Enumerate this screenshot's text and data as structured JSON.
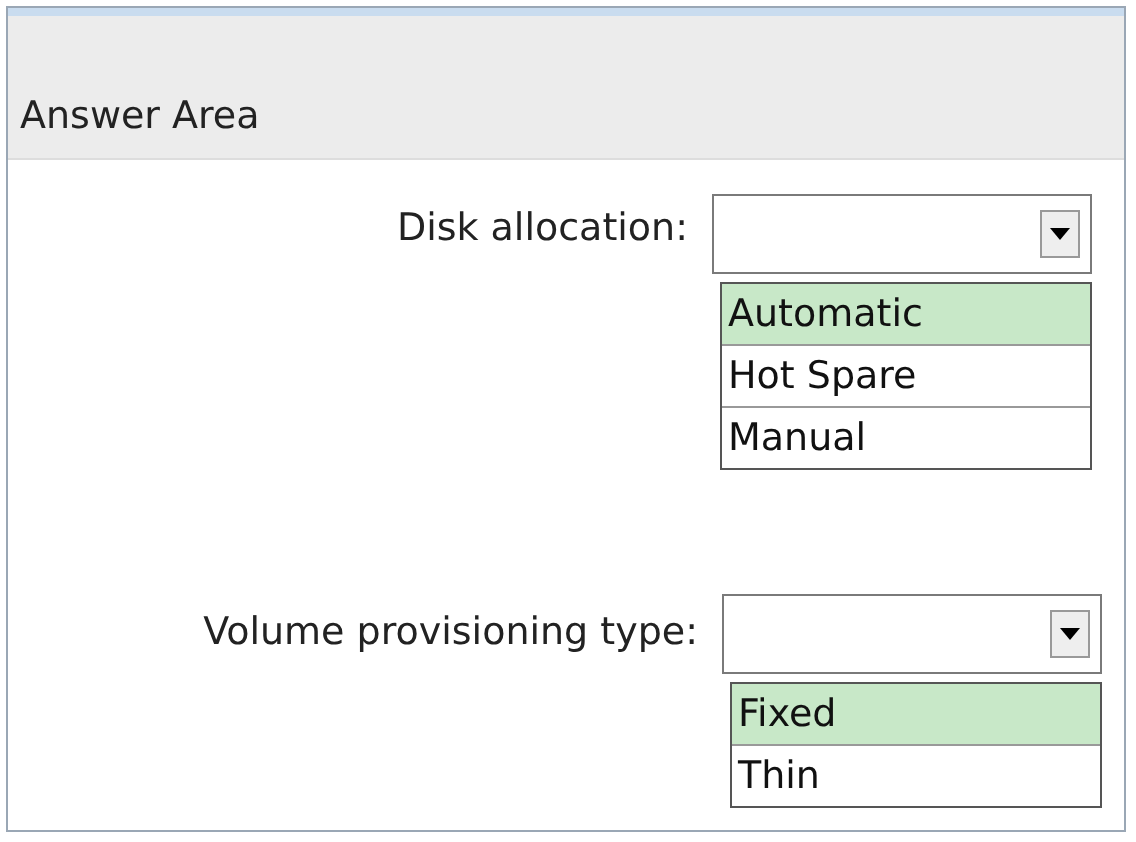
{
  "header": {
    "title": "Answer Area"
  },
  "fields": [
    {
      "label": "Disk allocation:",
      "options": [
        {
          "label": "Automatic",
          "selected": true
        },
        {
          "label": "Hot Spare",
          "selected": false
        },
        {
          "label": "Manual",
          "selected": false
        }
      ]
    },
    {
      "label": "Volume provisioning type:",
      "options": [
        {
          "label": "Fixed",
          "selected": true
        },
        {
          "label": "Thin",
          "selected": false
        }
      ]
    }
  ]
}
